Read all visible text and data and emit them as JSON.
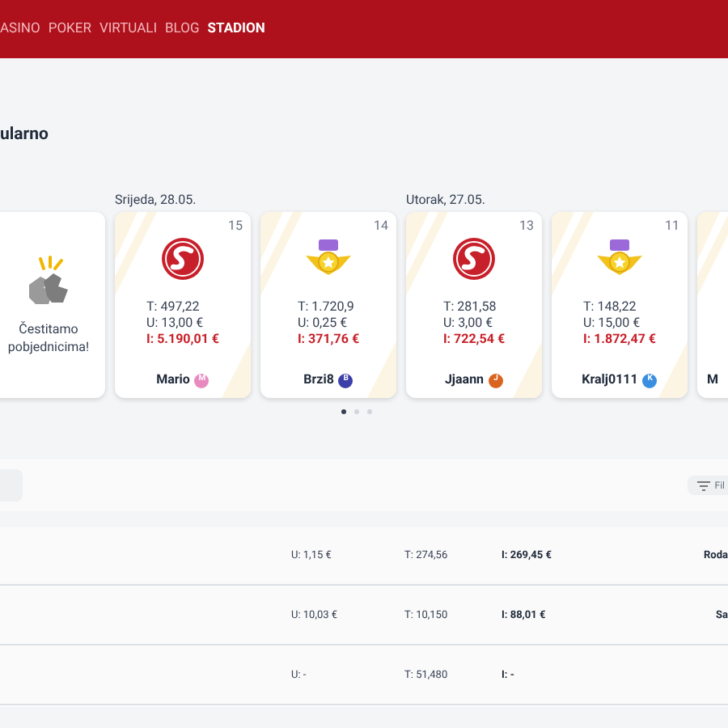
{
  "nav": [
    {
      "label": "ASINO",
      "selected": false
    },
    {
      "label": "POKER",
      "selected": false
    },
    {
      "label": "VIRTUALI",
      "selected": false
    },
    {
      "label": "BLOG",
      "selected": false
    },
    {
      "label": "STADION",
      "selected": true
    }
  ],
  "heading": "ularno",
  "congrats": "Čestitamo pobjednicima!",
  "cards": [
    {
      "date": "Srijeda, 28.05.",
      "rank": "15",
      "kind": "swoosh",
      "t": "T: 497,22",
      "u": "U: 13,00 €",
      "i": "I: 5.190,01 €",
      "name": "Mario",
      "initial": "M",
      "color": "#e88ac0"
    },
    {
      "rank": "14",
      "kind": "medal",
      "t": "T: 1.720,9",
      "u": "U: 0,25 €",
      "i": "I: 371,76 €",
      "name": "Brzi8",
      "initial": "B",
      "color": "#3b3fa8"
    },
    {
      "date": "Utorak, 27.05.",
      "rank": "13",
      "kind": "swoosh",
      "t": "T: 281,58",
      "u": "U: 3,00 €",
      "i": "I: 722,54 €",
      "name": "Jjaann",
      "initial": "J",
      "color": "#d9641e"
    },
    {
      "rank": "11",
      "kind": "medal",
      "t": "T: 148,22",
      "u": "U: 15,00 €",
      "i": "I: 1.872,47 €",
      "name": "Kralj0111",
      "initial": "K",
      "color": "#3a8fe0"
    },
    {
      "kind": "partial",
      "name": "M"
    }
  ],
  "pager": [
    {
      "selected": true
    },
    {
      "selected": false
    },
    {
      "selected": false
    }
  ],
  "filter": "Fil",
  "rows": [
    {
      "u": "U: 1,15 €",
      "t": "T: 274,56",
      "i": "I: 269,45 €",
      "name": "Roda"
    },
    {
      "u": "U: 10,03 €",
      "t": "T: 10,150",
      "i": "I: 88,01 €",
      "name": "Sa"
    },
    {
      "u": "U: -",
      "t": "T: 51,480",
      "i": "I: -"
    }
  ]
}
